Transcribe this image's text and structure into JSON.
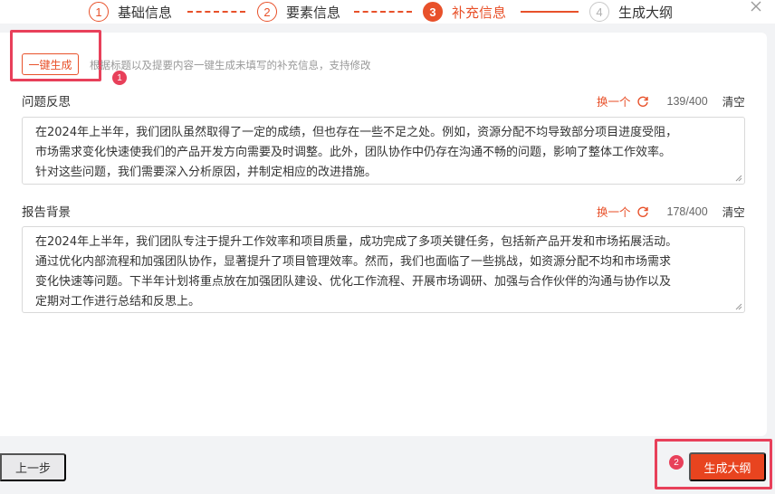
{
  "steps": [
    {
      "num": "1",
      "label": "基础信息"
    },
    {
      "num": "2",
      "label": "要素信息"
    },
    {
      "num": "3",
      "label": "补充信息"
    },
    {
      "num": "4",
      "label": "生成大纲"
    }
  ],
  "header": {
    "generate_all_label": "一键生成",
    "hint": "根据标题以及提要内容一键生成未填写的补充信息，支持修改"
  },
  "badges": {
    "first": "1",
    "second": "2"
  },
  "fields": [
    {
      "title": "问题反思",
      "swap_label": "换一个",
      "count": "139/400",
      "clear_label": "清空",
      "lines": [
        "在2024年上半年，我们团队虽然取得了一定的成绩，但也存在一些不足之处。例如，资源分配不均导致部分项目进度受阻，",
        "市场需求变化快速使我们的产品开发方向需要及时调整。此外，团队协作中仍存在沟通不畅的问题，影响了整体工作效率。",
        "针对这些问题，我们需要深入分析原因，并制定相应的改进措施。"
      ]
    },
    {
      "title": "报告背景",
      "swap_label": "换一个",
      "count": "178/400",
      "clear_label": "清空",
      "lines": [
        "在2024年上半年，我们团队专注于提升工作效率和项目质量，成功完成了多项关键任务，包括新产品开发和市场拓展活动。",
        "通过优化内部流程和加强团队协作，显著提升了项目管理效率。然而，我们也面临了一些挑战，如资源分配不均和市场需求",
        "变化快速等问题。下半年计划将重点放在加强团队建设、优化工作流程、开展市场调研、加强与合作伙伴的沟通与协作以及",
        "定期对工作进行总结和反思上。"
      ]
    }
  ],
  "footer": {
    "prev_label": "上一步",
    "generate_outline_label": "生成大纲"
  },
  "colors": {
    "accent": "#e8512a",
    "highlight": "#e8405a"
  }
}
